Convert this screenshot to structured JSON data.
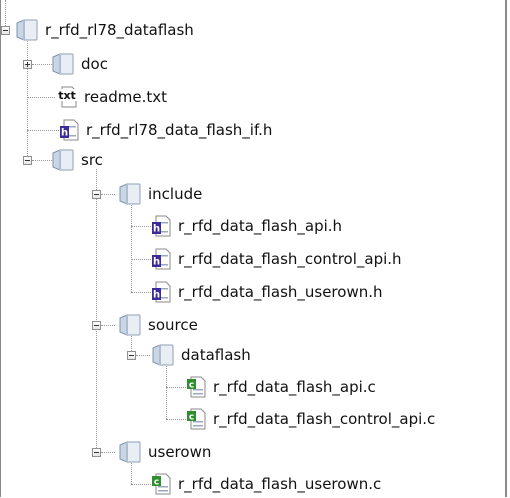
{
  "tree": {
    "root": {
      "label": "r_rfd_rl78_dataflash",
      "icon": "folder-icon",
      "expanded": true
    },
    "doc": {
      "label": "doc",
      "icon": "folder-icon",
      "expanded": false
    },
    "readme": {
      "label": "readme.txt",
      "icon": "text-file-icon",
      "icon_text": "txt"
    },
    "if_header": {
      "label": "r_rfd_rl78_data_flash_if.h",
      "icon": "header-file-icon"
    },
    "src": {
      "label": "src",
      "icon": "folder-icon",
      "expanded": true
    },
    "include": {
      "label": "include",
      "icon": "folder-icon",
      "expanded": true
    },
    "api_h": {
      "label": "r_rfd_data_flash_api.h",
      "icon": "header-file-icon"
    },
    "control_api_h": {
      "label": "r_rfd_data_flash_control_api.h",
      "icon": "header-file-icon"
    },
    "userown_h": {
      "label": "r_rfd_data_flash_userown.h",
      "icon": "header-file-icon"
    },
    "source": {
      "label": "source",
      "icon": "folder-icon",
      "expanded": true
    },
    "dataflash": {
      "label": "dataflash",
      "icon": "folder-icon",
      "expanded": true
    },
    "api_c": {
      "label": "r_rfd_data_flash_api.c",
      "icon": "c-file-icon"
    },
    "control_api_c": {
      "label": "r_rfd_data_flash_control_api.c",
      "icon": "c-file-icon"
    },
    "userown": {
      "label": "userown",
      "icon": "folder-icon",
      "expanded": true
    },
    "userown_c": {
      "label": "r_rfd_data_flash_userown.c",
      "icon": "c-file-icon"
    }
  },
  "colors": {
    "folder_front": "#c9d6e6",
    "folder_back": "#7f93ad",
    "header_accent": "#3a2a9a",
    "c_accent": "#2f8f2f"
  }
}
